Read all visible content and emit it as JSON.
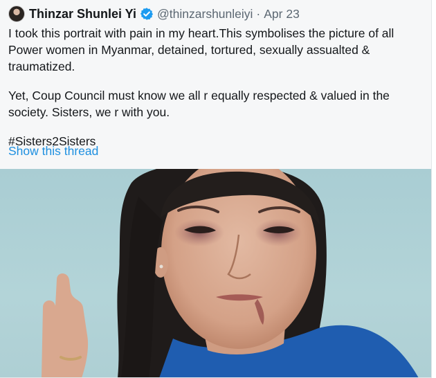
{
  "tweet": {
    "author_name": "Thinzar Shunlei Yi",
    "handle": "@thinzarshunleiyi",
    "separator": "·",
    "date": "Apr 23",
    "paragraphs": [
      "I took this portrait with pain in my heart.This symbolises the picture of all Power women in Myanmar, detained, tortured, sexually assualted & traumatized.",
      "Yet, Coup Council must know we all r equally respected & valued in the society. Sisters, we r with you.",
      "#Sisters2Sisters"
    ],
    "show_thread_label": "Show this thread"
  },
  "icons": {
    "verified": "verified-badge-icon",
    "avatar": "profile-avatar"
  },
  "colors": {
    "link": "#1d8fe0",
    "verified": "#1d9bf0",
    "text": "#14171a",
    "muted": "#5b6772",
    "card_background": "#f6f7f8"
  }
}
